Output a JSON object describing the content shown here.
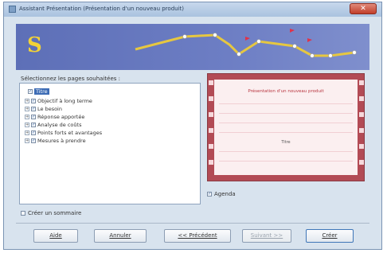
{
  "window": {
    "title": "Assistant Présentation (Présentation d'un nouveau produit)",
    "close_label": "✕"
  },
  "left": {
    "list_label": "Sélectionnez les pages souhaitées :",
    "tree_items": [
      {
        "label": "Titre",
        "selected": true,
        "expander": false
      },
      {
        "label": "Objectif à long terme",
        "selected": false,
        "expander": true
      },
      {
        "label": "Le besoin",
        "selected": false,
        "expander": true
      },
      {
        "label": "Réponse apportée",
        "selected": false,
        "expander": true
      },
      {
        "label": "Analyse de coûts",
        "selected": false,
        "expander": true
      },
      {
        "label": "Points forts et avantages",
        "selected": false,
        "expander": true
      },
      {
        "label": "Mesures à prendre",
        "selected": false,
        "expander": true
      }
    ]
  },
  "preview": {
    "slide_title": "Présentation d'un nouveau produit",
    "slide_subtitle": "Titre"
  },
  "checkboxes": {
    "agenda": "Agenda",
    "summary": "Créer un sommaire"
  },
  "buttons": {
    "help": "Aide",
    "cancel": "Annuler",
    "previous": "<< Précédent",
    "next": "Suivant >>",
    "finish": "Créer"
  },
  "colors": {
    "banner": "#6d7ec4",
    "logo": "#f2d237",
    "preview_frame": "#b24b55",
    "selection": "#3d6cb5"
  }
}
